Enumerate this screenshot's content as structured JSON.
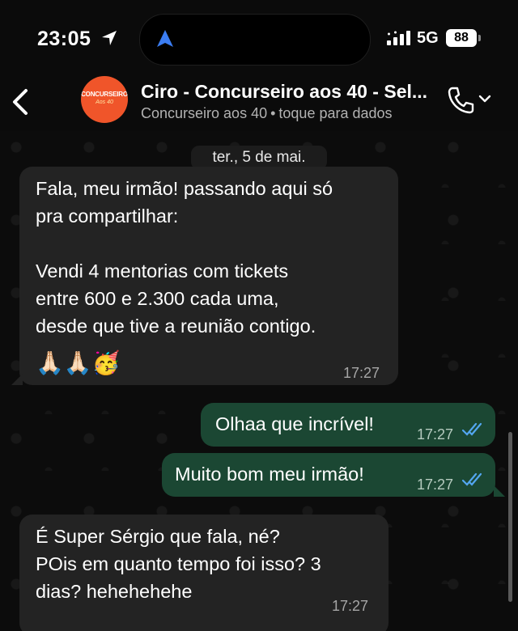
{
  "status": {
    "time": "23:05",
    "network": "5G",
    "battery": "88"
  },
  "header": {
    "title": "Ciro - Concurseiro aos 40 - Sel...",
    "subtitle": "Concurseiro aos 40",
    "subtitle_hint": "toque para dados",
    "avatar_text_1": "CONCURSEIRO",
    "avatar_text_2": "Aos 40"
  },
  "chat": {
    "date": "ter., 5 de mai.",
    "messages": [
      {
        "direction": "in",
        "text": "Fala, meu irmão! passando aqui só\npra compartilhar:\n\nVendi 4 mentorias com tickets\nentre 600 e 2.300 cada uma,\ndesde que tive a reunião contigo.",
        "emoji": "🙏🏻🙏🏻🥳",
        "time": "17:27"
      },
      {
        "direction": "out",
        "text": "Olhaa que incrível!",
        "time": "17:27",
        "read": true
      },
      {
        "direction": "out",
        "text": "Muito bom meu irmão!",
        "time": "17:27",
        "read": true
      },
      {
        "direction": "in",
        "text": "É Super Sérgio que fala, né?\nPOis em quanto tempo foi isso? 3\ndias? hehehehehe",
        "time": "17:27"
      }
    ]
  },
  "colors": {
    "incoming": "#232323",
    "outgoing": "#1b4733",
    "read_ticks": "#53a6f0",
    "avatar": "#f0552a"
  }
}
